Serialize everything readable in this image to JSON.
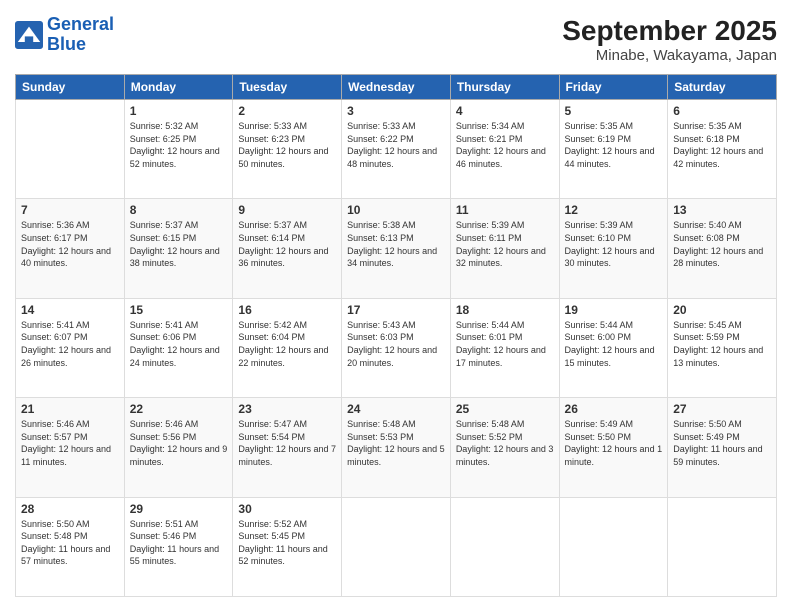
{
  "header": {
    "logo_line1": "General",
    "logo_line2": "Blue",
    "title": "September 2025",
    "subtitle": "Minabe, Wakayama, Japan"
  },
  "days_of_week": [
    "Sunday",
    "Monday",
    "Tuesday",
    "Wednesday",
    "Thursday",
    "Friday",
    "Saturday"
  ],
  "weeks": [
    [
      {
        "day": "",
        "sunrise": "",
        "sunset": "",
        "daylight": ""
      },
      {
        "day": "1",
        "sunrise": "Sunrise: 5:32 AM",
        "sunset": "Sunset: 6:25 PM",
        "daylight": "Daylight: 12 hours and 52 minutes."
      },
      {
        "day": "2",
        "sunrise": "Sunrise: 5:33 AM",
        "sunset": "Sunset: 6:23 PM",
        "daylight": "Daylight: 12 hours and 50 minutes."
      },
      {
        "day": "3",
        "sunrise": "Sunrise: 5:33 AM",
        "sunset": "Sunset: 6:22 PM",
        "daylight": "Daylight: 12 hours and 48 minutes."
      },
      {
        "day": "4",
        "sunrise": "Sunrise: 5:34 AM",
        "sunset": "Sunset: 6:21 PM",
        "daylight": "Daylight: 12 hours and 46 minutes."
      },
      {
        "day": "5",
        "sunrise": "Sunrise: 5:35 AM",
        "sunset": "Sunset: 6:19 PM",
        "daylight": "Daylight: 12 hours and 44 minutes."
      },
      {
        "day": "6",
        "sunrise": "Sunrise: 5:35 AM",
        "sunset": "Sunset: 6:18 PM",
        "daylight": "Daylight: 12 hours and 42 minutes."
      }
    ],
    [
      {
        "day": "7",
        "sunrise": "Sunrise: 5:36 AM",
        "sunset": "Sunset: 6:17 PM",
        "daylight": "Daylight: 12 hours and 40 minutes."
      },
      {
        "day": "8",
        "sunrise": "Sunrise: 5:37 AM",
        "sunset": "Sunset: 6:15 PM",
        "daylight": "Daylight: 12 hours and 38 minutes."
      },
      {
        "day": "9",
        "sunrise": "Sunrise: 5:37 AM",
        "sunset": "Sunset: 6:14 PM",
        "daylight": "Daylight: 12 hours and 36 minutes."
      },
      {
        "day": "10",
        "sunrise": "Sunrise: 5:38 AM",
        "sunset": "Sunset: 6:13 PM",
        "daylight": "Daylight: 12 hours and 34 minutes."
      },
      {
        "day": "11",
        "sunrise": "Sunrise: 5:39 AM",
        "sunset": "Sunset: 6:11 PM",
        "daylight": "Daylight: 12 hours and 32 minutes."
      },
      {
        "day": "12",
        "sunrise": "Sunrise: 5:39 AM",
        "sunset": "Sunset: 6:10 PM",
        "daylight": "Daylight: 12 hours and 30 minutes."
      },
      {
        "day": "13",
        "sunrise": "Sunrise: 5:40 AM",
        "sunset": "Sunset: 6:08 PM",
        "daylight": "Daylight: 12 hours and 28 minutes."
      }
    ],
    [
      {
        "day": "14",
        "sunrise": "Sunrise: 5:41 AM",
        "sunset": "Sunset: 6:07 PM",
        "daylight": "Daylight: 12 hours and 26 minutes."
      },
      {
        "day": "15",
        "sunrise": "Sunrise: 5:41 AM",
        "sunset": "Sunset: 6:06 PM",
        "daylight": "Daylight: 12 hours and 24 minutes."
      },
      {
        "day": "16",
        "sunrise": "Sunrise: 5:42 AM",
        "sunset": "Sunset: 6:04 PM",
        "daylight": "Daylight: 12 hours and 22 minutes."
      },
      {
        "day": "17",
        "sunrise": "Sunrise: 5:43 AM",
        "sunset": "Sunset: 6:03 PM",
        "daylight": "Daylight: 12 hours and 20 minutes."
      },
      {
        "day": "18",
        "sunrise": "Sunrise: 5:44 AM",
        "sunset": "Sunset: 6:01 PM",
        "daylight": "Daylight: 12 hours and 17 minutes."
      },
      {
        "day": "19",
        "sunrise": "Sunrise: 5:44 AM",
        "sunset": "Sunset: 6:00 PM",
        "daylight": "Daylight: 12 hours and 15 minutes."
      },
      {
        "day": "20",
        "sunrise": "Sunrise: 5:45 AM",
        "sunset": "Sunset: 5:59 PM",
        "daylight": "Daylight: 12 hours and 13 minutes."
      }
    ],
    [
      {
        "day": "21",
        "sunrise": "Sunrise: 5:46 AM",
        "sunset": "Sunset: 5:57 PM",
        "daylight": "Daylight: 12 hours and 11 minutes."
      },
      {
        "day": "22",
        "sunrise": "Sunrise: 5:46 AM",
        "sunset": "Sunset: 5:56 PM",
        "daylight": "Daylight: 12 hours and 9 minutes."
      },
      {
        "day": "23",
        "sunrise": "Sunrise: 5:47 AM",
        "sunset": "Sunset: 5:54 PM",
        "daylight": "Daylight: 12 hours and 7 minutes."
      },
      {
        "day": "24",
        "sunrise": "Sunrise: 5:48 AM",
        "sunset": "Sunset: 5:53 PM",
        "daylight": "Daylight: 12 hours and 5 minutes."
      },
      {
        "day": "25",
        "sunrise": "Sunrise: 5:48 AM",
        "sunset": "Sunset: 5:52 PM",
        "daylight": "Daylight: 12 hours and 3 minutes."
      },
      {
        "day": "26",
        "sunrise": "Sunrise: 5:49 AM",
        "sunset": "Sunset: 5:50 PM",
        "daylight": "Daylight: 12 hours and 1 minute."
      },
      {
        "day": "27",
        "sunrise": "Sunrise: 5:50 AM",
        "sunset": "Sunset: 5:49 PM",
        "daylight": "Daylight: 11 hours and 59 minutes."
      }
    ],
    [
      {
        "day": "28",
        "sunrise": "Sunrise: 5:50 AM",
        "sunset": "Sunset: 5:48 PM",
        "daylight": "Daylight: 11 hours and 57 minutes."
      },
      {
        "day": "29",
        "sunrise": "Sunrise: 5:51 AM",
        "sunset": "Sunset: 5:46 PM",
        "daylight": "Daylight: 11 hours and 55 minutes."
      },
      {
        "day": "30",
        "sunrise": "Sunrise: 5:52 AM",
        "sunset": "Sunset: 5:45 PM",
        "daylight": "Daylight: 11 hours and 52 minutes."
      },
      {
        "day": "",
        "sunrise": "",
        "sunset": "",
        "daylight": ""
      },
      {
        "day": "",
        "sunrise": "",
        "sunset": "",
        "daylight": ""
      },
      {
        "day": "",
        "sunrise": "",
        "sunset": "",
        "daylight": ""
      },
      {
        "day": "",
        "sunrise": "",
        "sunset": "",
        "daylight": ""
      }
    ]
  ]
}
